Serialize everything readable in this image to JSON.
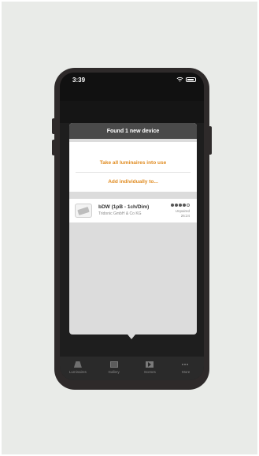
{
  "status_bar": {
    "time": "3:39",
    "wifi_icon": "wifi-icon",
    "battery_icon": "battery-icon"
  },
  "modal": {
    "title": "Found 1 new device",
    "actions": [
      {
        "label": "Take all luminaires into use"
      },
      {
        "label": "Add individually to..."
      }
    ],
    "accent_color": "#e08a1e",
    "device": {
      "name": "bDW (1pB - 1ch/Dim)",
      "vendor": "Tridonic GmbH & Co KG",
      "state": "Unpaired",
      "id": "26:24",
      "signal_level": 4,
      "signal_max": 5,
      "signal_icon": "signal-strength-icon"
    }
  },
  "tab_bar": {
    "tabs": [
      {
        "label": "Luminaires",
        "icon": "luminaire-icon"
      },
      {
        "label": "Gallery",
        "icon": "gallery-icon"
      },
      {
        "label": "Scenes",
        "icon": "scenes-icon"
      },
      {
        "label": "More",
        "icon": "more-icon"
      }
    ]
  }
}
